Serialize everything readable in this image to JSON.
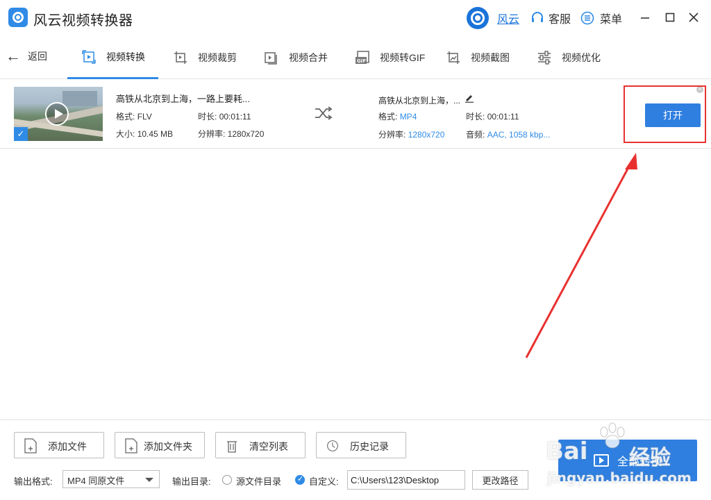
{
  "app": {
    "title": "风云视频转换器"
  },
  "header": {
    "user_name": "风云",
    "service_label": "客服",
    "menu_label": "菜单"
  },
  "nav": {
    "back_label": "返回",
    "tabs": [
      {
        "label": "视频转换",
        "active": true,
        "icon": "video-convert-icon"
      },
      {
        "label": "视频裁剪",
        "active": false,
        "icon": "video-crop-icon"
      },
      {
        "label": "视频合并",
        "active": false,
        "icon": "video-merge-icon"
      },
      {
        "label": "视频转GIF",
        "active": false,
        "icon": "gif-icon"
      },
      {
        "label": "视频截图",
        "active": false,
        "icon": "screenshot-icon"
      },
      {
        "label": "视频优化",
        "active": false,
        "icon": "optimize-icon"
      }
    ]
  },
  "file": {
    "source": {
      "name": "高铁从北京到上海，一路上要耗...",
      "format_label": "格式:",
      "format": "FLV",
      "duration_label": "时长:",
      "duration": "00:01:11",
      "size_label": "大小:",
      "size": "10.45 MB",
      "resolution_label": "分辨率:",
      "resolution": "1280x720"
    },
    "output": {
      "name": "高铁从北京到上海，...",
      "format_label": "格式:",
      "format": "MP4",
      "duration_label": "时长:",
      "duration": "00:01:11",
      "resolution_label": "分辨率:",
      "resolution": "1280x720",
      "audio_label": "音频:",
      "audio": "AAC, 1058 kbp..."
    },
    "open_button": "打开"
  },
  "bottom": {
    "add_file": "添加文件",
    "add_folder": "添加文件夹",
    "clear_list": "清空列表",
    "history": "历史记录",
    "output_format_label": "输出格式:",
    "output_format_value": "MP4 同原文件",
    "output_dir_label": "输出目录:",
    "source_dir_option": "源文件目录",
    "custom_option": "自定义:",
    "custom_path": "C:\\Users\\123\\Desktop",
    "change_path": "更改路径",
    "convert_all": "全部转换"
  },
  "watermark": {
    "brand": "Bai",
    "brand_tail": "经验",
    "url": "jingyan.baidu.com"
  },
  "colors": {
    "accent": "#2f7fe0",
    "highlight": "#e8312f"
  }
}
